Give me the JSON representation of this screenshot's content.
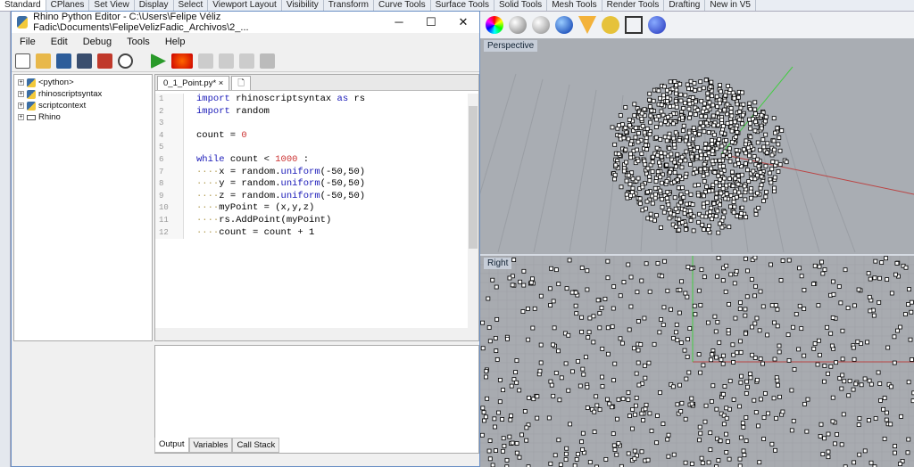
{
  "rhino": {
    "tabs": [
      "Standard",
      "CPlanes",
      "Set View",
      "Display",
      "Select",
      "Viewport Layout",
      "Visibility",
      "Transform",
      "Curve Tools",
      "Surface Tools",
      "Solid Tools",
      "Mesh Tools",
      "Render Tools",
      "Drafting",
      "New in V5"
    ],
    "viewports": {
      "top": "Perspective",
      "bottom": "Right"
    },
    "axes": {
      "z": "z",
      "y": "y",
      "x": "x"
    }
  },
  "editor": {
    "title": "Rhino Python Editor - C:\\Users\\Felipe Véliz Fadic\\Documents\\FelipeVelizFadic_Archivos\\2_...",
    "menu": [
      "File",
      "Edit",
      "Debug",
      "Tools",
      "Help"
    ],
    "tree": [
      "<python>",
      "rhinoscriptsyntax",
      "scriptcontext",
      "Rhino"
    ],
    "tab": "0_1_Point.py*",
    "lines": [
      "1",
      "2",
      "3",
      "4",
      "5",
      "6",
      "7",
      "8",
      "9",
      "10",
      "11",
      "12"
    ],
    "output_tabs": [
      "Output",
      "Variables",
      "Call Stack"
    ]
  },
  "colors": {
    "accent": "#1a1ab8",
    "x_axis": "#c0392b",
    "y_axis": "#2ecc40"
  }
}
